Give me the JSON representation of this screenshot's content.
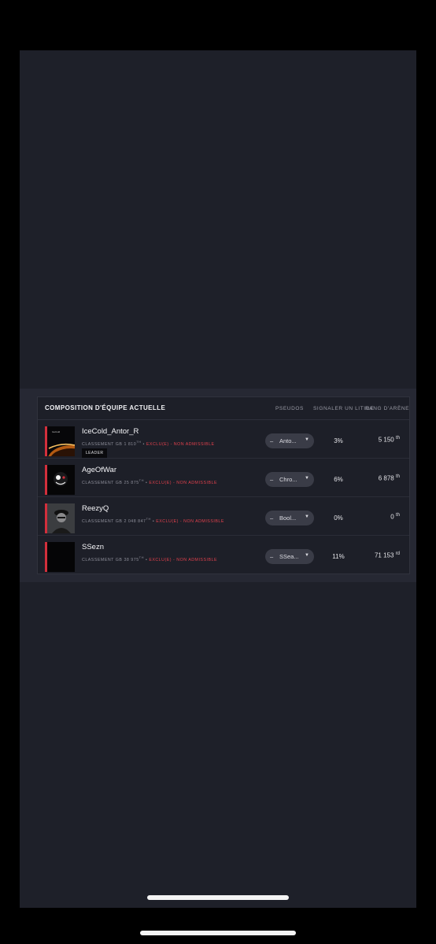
{
  "team": {
    "title": "COMPOSITION D'ÉQUIPE ACTUELLE",
    "columns": {
      "pseudos": "PSEUDOS",
      "report": "SIGNALER UN LITIGE",
      "rank": "RANG D'ARÈNE"
    },
    "rank_label": "CLASSEMENT GB",
    "leader_label": "LEADER",
    "players": [
      {
        "name": "IceCold_Antor_R",
        "classement": "1 810",
        "classement_suffix": "TH",
        "status": "EXCLU(E) - NON ADMISSIBLE",
        "pseudo": "Anto...",
        "report_pct": "3%",
        "arena_rank": "5 150",
        "arena_suffix": "th",
        "is_leader": true
      },
      {
        "name": "AgeOfWar",
        "classement": "25 875",
        "classement_suffix": "TH",
        "status": "EXCLU(E) - NON ADMISSIBLE",
        "pseudo": "Chro...",
        "report_pct": "6%",
        "arena_rank": "6 878",
        "arena_suffix": "th"
      },
      {
        "name": "ReezyQ",
        "classement": "2 048 847",
        "classement_suffix": "TH",
        "status": "EXCLU(E) - NON ADMISSIBLE",
        "pseudo": "Bool...",
        "report_pct": "0%",
        "arena_rank": "0",
        "arena_suffix": "th"
      },
      {
        "name": "SSezn",
        "classement": "38 975",
        "classement_suffix": "TH",
        "status": "EXCLU(E) - NON ADMISSIBLE",
        "pseudo": "SSea...",
        "report_pct": "11%",
        "arena_rank": "71 153",
        "arena_suffix": "rd"
      }
    ]
  },
  "colors": {
    "accent_red": "#e0404c",
    "background": "#1e2029",
    "card": "#1d1f28"
  }
}
